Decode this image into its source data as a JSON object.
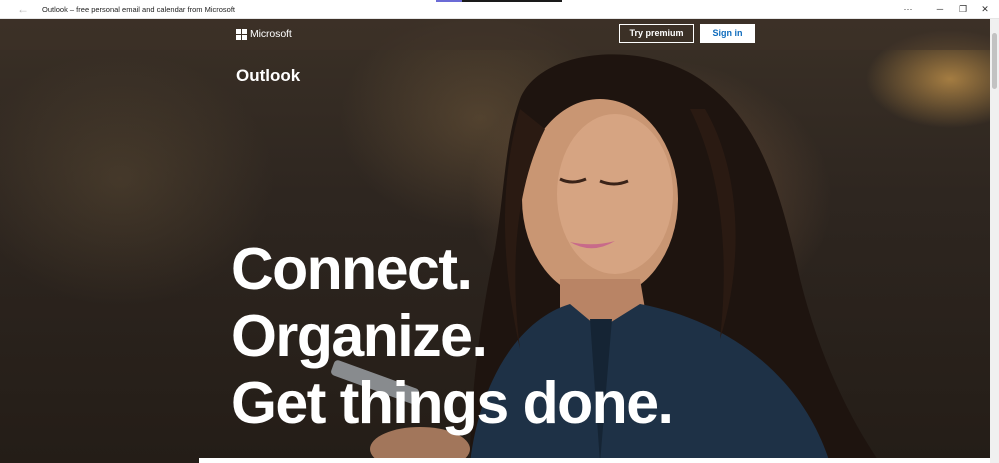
{
  "window": {
    "title": "Outlook – free personal email and calendar from Microsoft",
    "back_icon": "←",
    "more_icon": "···",
    "minimize_icon": "─",
    "maximize_icon": "❐",
    "close_icon": "✕"
  },
  "nav": {
    "logo_text": "Microsoft",
    "try_premium": "Try premium",
    "sign_in": "Sign in"
  },
  "brand": "Outlook",
  "hero": {
    "line1": "Connect.",
    "line2": "Organize.",
    "line3": "Get things done."
  },
  "colors": {
    "sign_in_text": "#0f6cbd",
    "progress_accent": "#6b6bd6"
  }
}
